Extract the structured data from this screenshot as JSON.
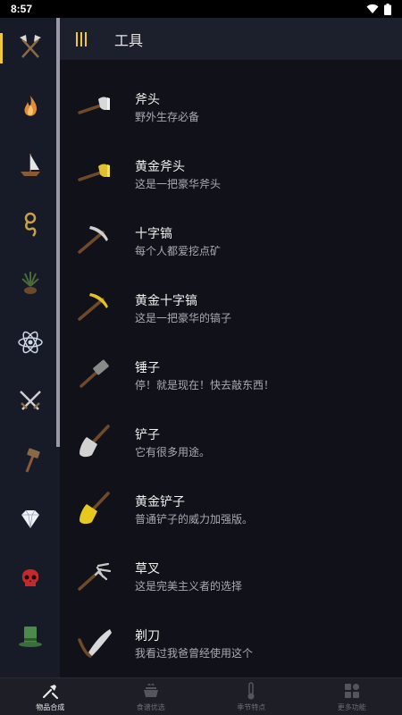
{
  "status_bar": {
    "time": "8:57"
  },
  "header": {
    "title": "工具"
  },
  "sidebar": {
    "items": [
      {
        "icon": "crossed-axes-icon"
      },
      {
        "icon": "fire-icon"
      },
      {
        "icon": "boat-icon"
      },
      {
        "icon": "rope-icon"
      },
      {
        "icon": "plant-icon"
      },
      {
        "icon": "atom-icon"
      },
      {
        "icon": "crossed-swords-icon"
      },
      {
        "icon": "hammer-icon"
      },
      {
        "icon": "diamond-icon"
      },
      {
        "icon": "skull-icon"
      },
      {
        "icon": "top-hat-icon"
      }
    ]
  },
  "items": [
    {
      "name": "斧头",
      "desc": "野外生存必备",
      "icon": "axe-icon"
    },
    {
      "name": "黄金斧头",
      "desc": "这是一把豪华斧头",
      "icon": "golden-axe-icon"
    },
    {
      "name": "十字镐",
      "desc": "每个人都爱挖点矿",
      "icon": "pickaxe-icon"
    },
    {
      "name": "黄金十字镐",
      "desc": "这是一把豪华的镐子",
      "icon": "golden-pickaxe-icon"
    },
    {
      "name": "锤子",
      "desc": "停！就是现在！快去敲东西！",
      "icon": "hammer-icon"
    },
    {
      "name": "铲子",
      "desc": "它有很多用途。",
      "icon": "shovel-icon"
    },
    {
      "name": "黄金铲子",
      "desc": "普通铲子的威力加强版。",
      "icon": "golden-shovel-icon"
    },
    {
      "name": "草叉",
      "desc": "这是完美主义者的选择",
      "icon": "pitchfork-icon"
    },
    {
      "name": "剃刀",
      "desc": "我看过我爸曾经使用这个",
      "icon": "razor-icon"
    }
  ],
  "bottom_nav": {
    "tabs": [
      {
        "label": "物品合成",
        "icon": "crafting-icon",
        "active": true
      },
      {
        "label": "食谱优选",
        "icon": "crockpot-icon",
        "active": false
      },
      {
        "label": "季节特点",
        "icon": "thermometer-icon",
        "active": false
      },
      {
        "label": "更多功能",
        "icon": "more-features-icon",
        "active": false
      }
    ]
  },
  "colors": {
    "accent": "#f0c83a",
    "sidebar_bg": "#171a27",
    "header_bg": "#1c1f2c",
    "list_bg": "#111219",
    "nav_bg": "#1e1f26"
  }
}
